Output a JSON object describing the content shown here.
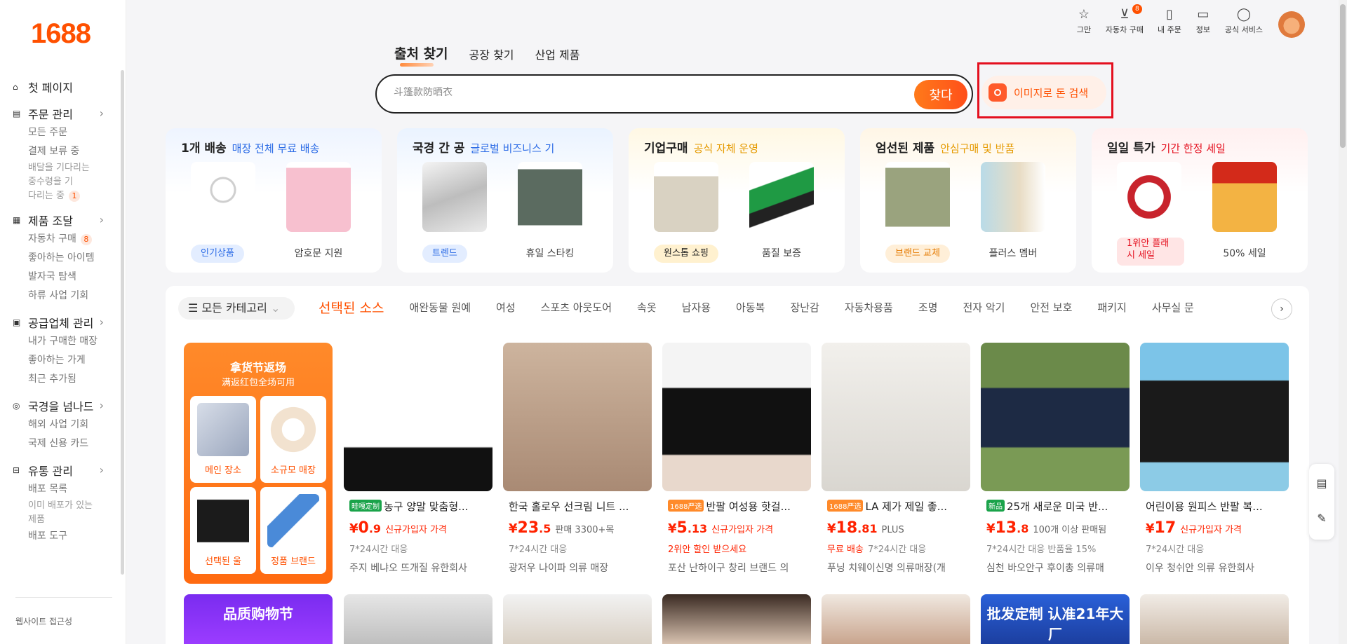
{
  "brand": {
    "logo": "1688",
    "accent": "#ff5000"
  },
  "sidebar": {
    "groups": [
      {
        "icon": "home-icon",
        "glyph": "⌂",
        "label": "첫 페이지",
        "chevron": false,
        "items": []
      },
      {
        "icon": "order-icon",
        "glyph": "▤",
        "label": "주문 관리",
        "chevron": true,
        "items": [
          {
            "label": "모든 주문"
          },
          {
            "label": "결제 보류 중"
          },
          {
            "label": "배달을 기다리는",
            "clip": true
          },
          {
            "label": "중수령을 기",
            "clip": true
          },
          {
            "label": "다리는 중",
            "clip": true,
            "badge": "1"
          }
        ]
      },
      {
        "icon": "grid-icon",
        "glyph": "▦",
        "label": "제품 조달",
        "chevron": true,
        "items": [
          {
            "label": "자동차 구매",
            "badge": "8"
          },
          {
            "label": "좋아하는 아이템"
          },
          {
            "label": "발자국 탐색"
          },
          {
            "label": "하류 사업 기회"
          }
        ]
      },
      {
        "icon": "supplier-icon",
        "glyph": "▣",
        "label": "공급업체 관리",
        "chevron": true,
        "items": [
          {
            "label": "내가 구매한 매장"
          },
          {
            "label": "좋아하는 가게"
          },
          {
            "label": "최근 추가됨"
          }
        ]
      },
      {
        "icon": "globe-icon",
        "glyph": "◎",
        "label": "국경을 넘나드",
        "chevron": true,
        "items": [
          {
            "label": "해외 사업 기회"
          },
          {
            "label": "국제 신용 카드"
          }
        ]
      },
      {
        "icon": "distribution-icon",
        "glyph": "⊟",
        "label": "유통 관리",
        "chevron": true,
        "items": [
          {
            "label": "배포 목록"
          },
          {
            "label": "이미 배포가 있는",
            "clip": true
          },
          {
            "label": "제품",
            "clip": true
          },
          {
            "label": "배포 도구"
          }
        ]
      }
    ],
    "footer": "웹사이트 접근성"
  },
  "topbar": [
    {
      "icon": "star-icon",
      "glyph": "☆",
      "label": "그만"
    },
    {
      "icon": "cart-icon",
      "glyph": "⊻",
      "label": "자동차 구매",
      "badge": "8"
    },
    {
      "icon": "clipboard-icon",
      "glyph": "▯",
      "label": "내 주문"
    },
    {
      "icon": "message-icon",
      "glyph": "▭",
      "label": "정보"
    },
    {
      "icon": "user-icon",
      "glyph": "◯",
      "label": "공식 서비스"
    }
  ],
  "search": {
    "tabs": [
      "출처 찾기",
      "공장 찾기",
      "산업 제품"
    ],
    "placeholder": "斗篷款防晒衣",
    "button": "찾다",
    "image_search": "이미지로 돈 검색"
  },
  "promos": [
    {
      "title": "1개 배송",
      "subtitle": "매장 전체 무료 배송",
      "subColor": "#2b6be6",
      "bg": "linear-gradient(180deg,#eef4ff,#ffffff 45%)",
      "tag": "인기상품",
      "tagColor": "#2b6be6",
      "tagBg": "#e3edff",
      "label": "암호문 지원",
      "img1": "radial-gradient(circle at 50% 40%,#fff 0 20%,#cfcfcf 21% 24%,#fff 25% 100%)",
      "img2": "linear-gradient(180deg,#ffffff 0 8%,#f7c0cf 9% 100%)"
    },
    {
      "title": "국경 간 공",
      "subtitle": "글로벌 비즈니스 기",
      "subColor": "#2b6be6",
      "bg": "linear-gradient(180deg,#eaf3ff,#ffffff 45%)",
      "tag": "트렌드",
      "tagColor": "#2b6be6",
      "tagBg": "#e3edff",
      "label": "휴일 스타킹",
      "img1": "linear-gradient(160deg,#f4f4f4,#bdbdbd 50%,#eaeaea)",
      "img2": "linear-gradient(180deg,#ffffff 0 10%,#5b6b60 11% 90%,#ffffff 91%)"
    },
    {
      "title": "기업구매",
      "subtitle": "공식 자체 운영",
      "subColor": "#e59a00",
      "bg": "linear-gradient(180deg,#fff8e4,#ffffff 45%)",
      "tag": "원스톱 쇼핑",
      "tagColor": "#222",
      "tagBg": "#fff1cf",
      "label": "품질 보증",
      "img1": "linear-gradient(180deg,#ffffff 0 20%,#d9d2c2 21% 100%)",
      "img2": "linear-gradient(160deg,#ffffff 30%,#1f9a44 31% 55%,#222 56% 70%,#ffffff 71%)"
    },
    {
      "title": "엄선된 제품",
      "subtitle": "안심구매 및 반품",
      "subColor": "#e59a00",
      "bg": "linear-gradient(180deg,#fff6e6,#ffffff 45%)",
      "tag": "브랜드 교체",
      "tagColor": "#e57a00",
      "tagBg": "#ffefd8",
      "label": "플러스 멤버",
      "img1": "linear-gradient(180deg,#ffffff 0 8%,#9aa37e 9% 92%,#ffffff 93%)",
      "img2": "linear-gradient(90deg,#b9dbe8,#e8dcc4 60%,#ffffff)"
    },
    {
      "title": "일일 특가",
      "subtitle": "기간 한정 세일",
      "subColor": "#e4101f",
      "bg": "linear-gradient(180deg,#fff0f0,#ffffff 45%)",
      "tag": "1위안 플래시 세일",
      "tagColor": "#e4101f",
      "tagBg": "#ffe5e5",
      "label": "50% 세일",
      "img1": "radial-gradient(circle,#ffffff 0 30%,#c8232c 31% 45%,#ffffff 46%)",
      "img2": "linear-gradient(180deg,#d32a1a 0 30%,#f3b343 31% 100%)"
    }
  ],
  "categories": {
    "all": "모든 카테고리",
    "items": [
      "선택된 소스",
      "애완동물 원예",
      "여성",
      "스포츠 아웃도어",
      "속옷",
      "남자용",
      "아동복",
      "장난감",
      "자동차용품",
      "조명",
      "전자 악기",
      "안전 보호",
      "패키지",
      "사무실 문"
    ]
  },
  "feature": {
    "title": "拿货节返场",
    "subtitle": "满返红包全场可用",
    "cells": [
      {
        "label": "메인 장소",
        "img": "linear-gradient(135deg,#d7dde8,#9aa6bd)"
      },
      {
        "label": "소규모 매장",
        "img": "radial-gradient(circle,#ffffff 0 30%,#f2e2cf 31% 60%,#ffffff 61%)"
      },
      {
        "label": "선택된 울",
        "img": "linear-gradient(180deg,#ffffff 0 10%,#1b1b1b 11% 90%,#ffffff 91%)"
      },
      {
        "label": "정품 브랜드",
        "img": "linear-gradient(135deg,#ffffff 30%,#4a8ad8 31% 55%,#ffffff 56%)"
      }
    ]
  },
  "products": [
    {
      "badge": "畦嘎定制",
      "badgeColor": "#1aa34a",
      "title": "농구 양말 맞춤형...",
      "yen": "¥",
      "int": "0",
      "dec": ".9",
      "note": "신규가입자 가격",
      "noteRed": true,
      "line2Red": "",
      "line2": "7*24시간 대응",
      "shop": "주지 베냐오 뜨개질 유한회사",
      "img": "linear-gradient(180deg,#ffffff 0 70%,#111 71% 100%)"
    },
    {
      "badge": "",
      "badgeColor": "",
      "title": "한국 홀로우 선크림 니트 ...",
      "yen": "¥",
      "int": "23",
      "dec": ".5",
      "note": "판매 3300+목",
      "noteRed": false,
      "line2Red": "",
      "line2": "7*24시간 대응",
      "shop": "광저우 나이파 의류 매장",
      "img": "linear-gradient(180deg,#cdb49e,#a98a74)"
    },
    {
      "badge": "1688严选",
      "badgeColor": "#ff8a2a",
      "title": "반팔 여성용 핫걸...",
      "yen": "¥",
      "int": "5",
      "dec": ".13",
      "note": "신규가입자 가격",
      "noteRed": true,
      "line2Red": "2위안 할인 받으세요",
      "line2": "",
      "shop": "포산 난하이구 창리 브랜드 의",
      "img": "linear-gradient(180deg,#f4f4f4 0 30%,#111 31% 75%,#e8d8cc 76%)"
    },
    {
      "badge": "1688严选",
      "badgeColor": "#ff8a2a",
      "title": "LA 제가 제일 좋...",
      "yen": "¥",
      "int": "18",
      "dec": ".81",
      "note": "PLUS",
      "noteRed": false,
      "line2Red": "무료 배송",
      "line2": "7*24시간 대응",
      "shop": "푸닝 치웨이신명 의류매장(개",
      "img": "linear-gradient(180deg,#f2f0ec,#d9d6d0)"
    },
    {
      "badge": "新品",
      "badgeColor": "#1aa34a",
      "title": "25개 새로운 미국 반...",
      "yen": "¥",
      "int": "13",
      "dec": ".8",
      "note": "100개 이상 판매됨",
      "noteRed": false,
      "line2Red": "",
      "line2": "7*24시간 대응  반품율 15%",
      "shop": "심천 바오안구 후이총 의류매",
      "img": "linear-gradient(180deg,#6b8a4a 0 30%,#1d2a44 31% 70%,#7a9a55 71%)"
    },
    {
      "badge": "",
      "badgeColor": "",
      "title": "어린이용 원피스 반팔 복...",
      "yen": "¥",
      "int": "17",
      "dec": "",
      "note": "신규가입자 가격",
      "noteRed": true,
      "line2Red": "",
      "line2": "7*24시간 대응",
      "shop": "이우 청쉬안 의류 유한회사",
      "img": "linear-gradient(180deg,#7cc4e8 0 25%,#1a1a1a 26% 80%,#8ccbe6 81%)"
    }
  ],
  "second_row": [
    {
      "title": "品质购物节",
      "img": "linear-gradient(180deg,#7a2cf0,#9b3cff)"
    },
    {
      "title": "",
      "img": "linear-gradient(180deg,#e6e6e6,#bfbfbf)"
    },
    {
      "title": "",
      "img": "linear-gradient(180deg,#f2f2f2,#d9d0c4)"
    },
    {
      "title": "",
      "img": "linear-gradient(180deg,#3a2a22,#d8c2b0)"
    },
    {
      "title": "",
      "img": "linear-gradient(180deg,#f0e8e0,#c9a58e)"
    },
    {
      "title": "批发定制 认准21年大厂",
      "img": "linear-gradient(180deg,#2a60d8,#1c3fa0)"
    },
    {
      "title": "",
      "img": "linear-gradient(180deg,#f1ece6,#cbb9a8)"
    }
  ]
}
